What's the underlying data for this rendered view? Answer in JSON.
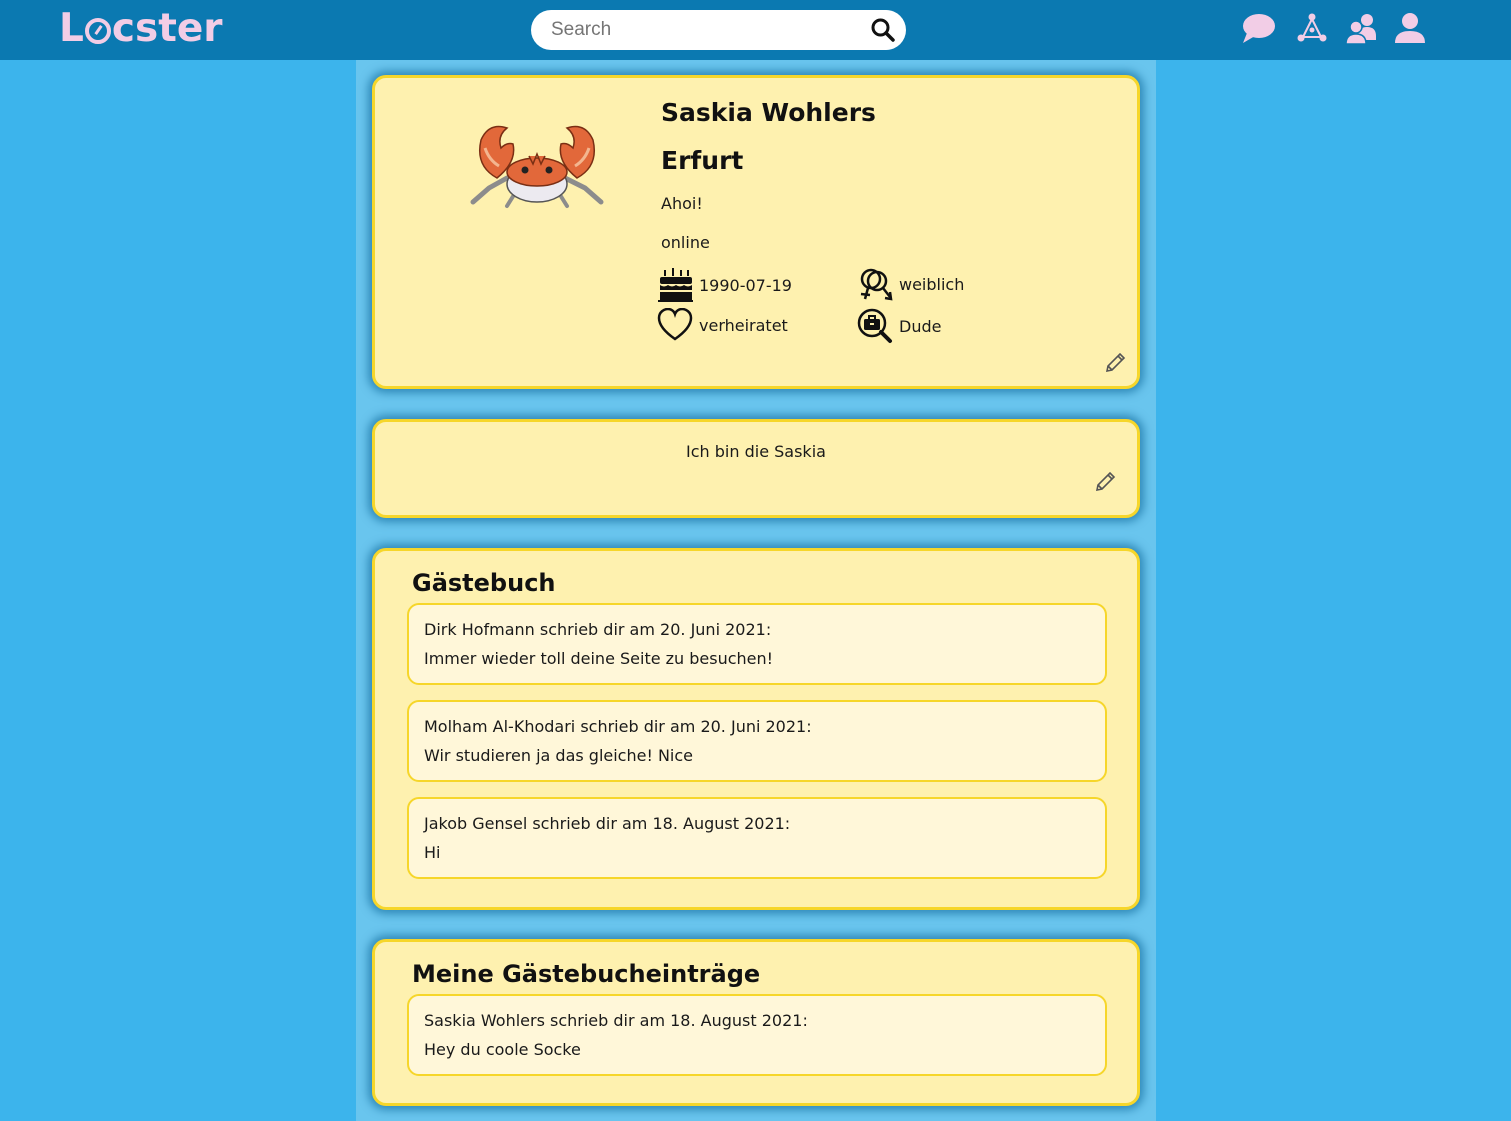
{
  "header": {
    "logo_text": "Locster",
    "logo_l": "L",
    "logo_rest": "cster",
    "search_placeholder": "Search",
    "nav_icons": [
      "chat-icon",
      "network-icon",
      "friends-icon",
      "profile-icon"
    ]
  },
  "profile": {
    "name": "Saskia Wohlers",
    "city": "Erfurt",
    "status_message": "Ahoi!",
    "online_status": "online",
    "birthday": "1990-07-19",
    "gender": "weiblich",
    "relationship": "verheiratet",
    "looking_for": "Dude"
  },
  "about": {
    "text": "Ich bin die Saskia"
  },
  "guestbook": {
    "title": "Gästebuch",
    "entries": [
      {
        "header": "Dirk Hofmann schrieb dir am 20. Juni 2021:",
        "message": "Immer wieder toll deine Seite zu besuchen!"
      },
      {
        "header": "Molham Al-Khodari schrieb dir am 20. Juni 2021:",
        "message": "Wir studieren ja das gleiche! Nice"
      },
      {
        "header": "Jakob Gensel schrieb dir am 18. August 2021:",
        "message": "Hi"
      }
    ]
  },
  "my_entries": {
    "title": "Meine Gästebucheinträge",
    "entries": [
      {
        "header": "Saskia Wohlers schrieb dir am 18. August 2021:",
        "message": "Hey du coole Socke"
      }
    ]
  },
  "colors": {
    "page_background": "#3cb4ec",
    "header_background": "#0b79b1",
    "card_background": "#fef1af",
    "card_border": "#f6d62a",
    "logo": "#f2cde6"
  }
}
